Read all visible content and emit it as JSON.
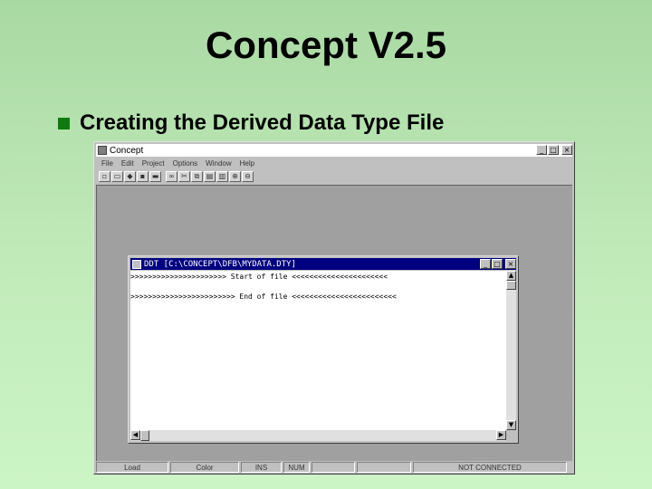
{
  "slide": {
    "title": "Concept V2.5",
    "bullet": "Creating the Derived Data Type File"
  },
  "app": {
    "title": "Concept",
    "menu": [
      "File",
      "Edit",
      "Project",
      "Options",
      "Window",
      "Help"
    ],
    "toolbar_icons": [
      "new-file-icon",
      "open-file-icon",
      "network-icon",
      "window-icon",
      "folder-icon",
      "binoculars-icon",
      "cut-icon",
      "copy-icon",
      "paste-icon",
      "print-icon",
      "zoom-in-icon",
      "zoom-out-icon"
    ],
    "status": [
      "Load",
      "Color",
      "INS",
      "NUM",
      "",
      "",
      "NOT CONNECTED"
    ]
  },
  "ddt_window": {
    "title": "DDT [C:\\CONCEPT\\DFB\\MYDATA.DTY]",
    "lines": [
      ">>>>>>>>>>>>>>>>>>>>>> Start of file <<<<<<<<<<<<<<<<<<<<<<",
      "",
      ">>>>>>>>>>>>>>>>>>>>>>>> End of file <<<<<<<<<<<<<<<<<<<<<<<<"
    ]
  },
  "window_buttons": {
    "minimize": "_",
    "maximize": "□",
    "close": "×"
  }
}
